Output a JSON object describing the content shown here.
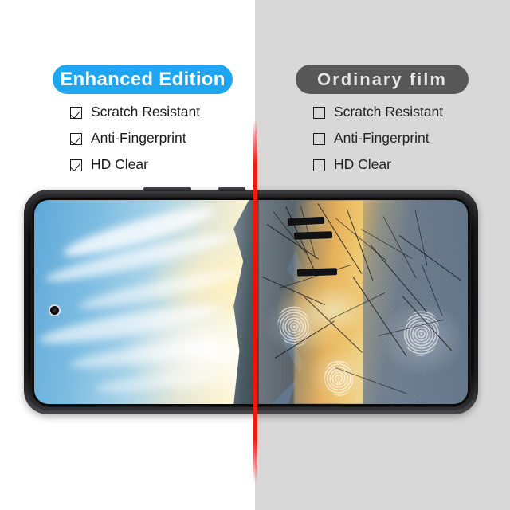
{
  "comparison": {
    "left": {
      "badge_label": "Enhanced Edition",
      "badge_color": "#1fa6f0",
      "badge_text_color": "#ffffff",
      "features": [
        {
          "label": "Scratch Resistant",
          "checked": true
        },
        {
          "label": "Anti-Fingerprint",
          "checked": true
        },
        {
          "label": "HD Clear",
          "checked": true
        }
      ]
    },
    "right": {
      "badge_label": "Ordinary film",
      "badge_color": "#575757",
      "badge_text_color": "#e6e6e6",
      "features": [
        {
          "label": "Scratch Resistant",
          "checked": false
        },
        {
          "label": "Anti-Fingerprint",
          "checked": false
        },
        {
          "label": "HD Clear",
          "checked": false
        }
      ]
    },
    "divider_color": "#ed1c18",
    "background_left_color": "#ffffff",
    "background_right_color": "#d8d8d8"
  },
  "device": {
    "orientation": "landscape",
    "frame_color": "#121214",
    "wallpaper_description": "sunset landscape with blue sky, clouds, mountain ridge and golden light",
    "camera_icon": "punch-hole-camera-icon",
    "buttons": [
      "volume-button",
      "power-button"
    ]
  },
  "damage_overlay": {
    "scratch_icon": "scratch-mark-icon",
    "fingerprint_icon": "fingerprint-smudge-icon",
    "haze_icon": "haze-overlay-icon"
  }
}
